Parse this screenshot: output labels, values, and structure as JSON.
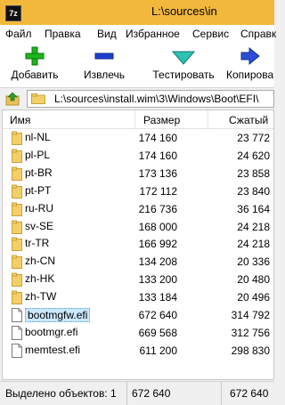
{
  "window": {
    "title": "L:\\sources\\in"
  },
  "menu": [
    "Файл",
    "Правка",
    "Вид",
    "Избранное",
    "Сервис",
    "Справк"
  ],
  "toolbar": {
    "add": {
      "label": "Добавить",
      "icon": "plus-icon",
      "color": "#1fb31f"
    },
    "extract": {
      "label": "Извлечь",
      "icon": "minus-icon",
      "color": "#1c3fcf"
    },
    "test": {
      "label": "Тестировать",
      "icon": "check-icon",
      "color": "#2bc3b4"
    },
    "copy": {
      "label": "Копирова",
      "icon": "arrow-right-icon",
      "color": "#2a4fd6"
    }
  },
  "address": {
    "path": "L:\\sources\\install.wim\\3\\Windows\\Boot\\EFI\\"
  },
  "columns": {
    "name": "Имя",
    "size": "Размер",
    "packed": "Сжатый"
  },
  "files": [
    {
      "name": "nl-NL",
      "type": "folder",
      "size": "174 160",
      "packed": "23 772"
    },
    {
      "name": "pl-PL",
      "type": "folder",
      "size": "174 160",
      "packed": "24 620"
    },
    {
      "name": "pt-BR",
      "type": "folder",
      "size": "173 136",
      "packed": "23 858"
    },
    {
      "name": "pt-PT",
      "type": "folder",
      "size": "172 112",
      "packed": "23 840"
    },
    {
      "name": "ru-RU",
      "type": "folder",
      "size": "216 736",
      "packed": "36 164"
    },
    {
      "name": "sv-SE",
      "type": "folder",
      "size": "168 000",
      "packed": "24 218"
    },
    {
      "name": "tr-TR",
      "type": "folder",
      "size": "166 992",
      "packed": "24 218"
    },
    {
      "name": "zh-CN",
      "type": "folder",
      "size": "134 208",
      "packed": "20 336"
    },
    {
      "name": "zh-HK",
      "type": "folder",
      "size": "133 200",
      "packed": "20 480"
    },
    {
      "name": "zh-TW",
      "type": "folder",
      "size": "133 184",
      "packed": "20 496"
    },
    {
      "name": "bootmgfw.efi",
      "type": "file",
      "size": "672 640",
      "packed": "314 792",
      "selected": true
    },
    {
      "name": "bootmgr.efi",
      "type": "file",
      "size": "669 568",
      "packed": "312 756"
    },
    {
      "name": "memtest.efi",
      "type": "file",
      "size": "611 200",
      "packed": "298 830"
    }
  ],
  "status": {
    "selected": "Выделено объектов: 1",
    "size": "672 640",
    "packed": "672 640"
  }
}
